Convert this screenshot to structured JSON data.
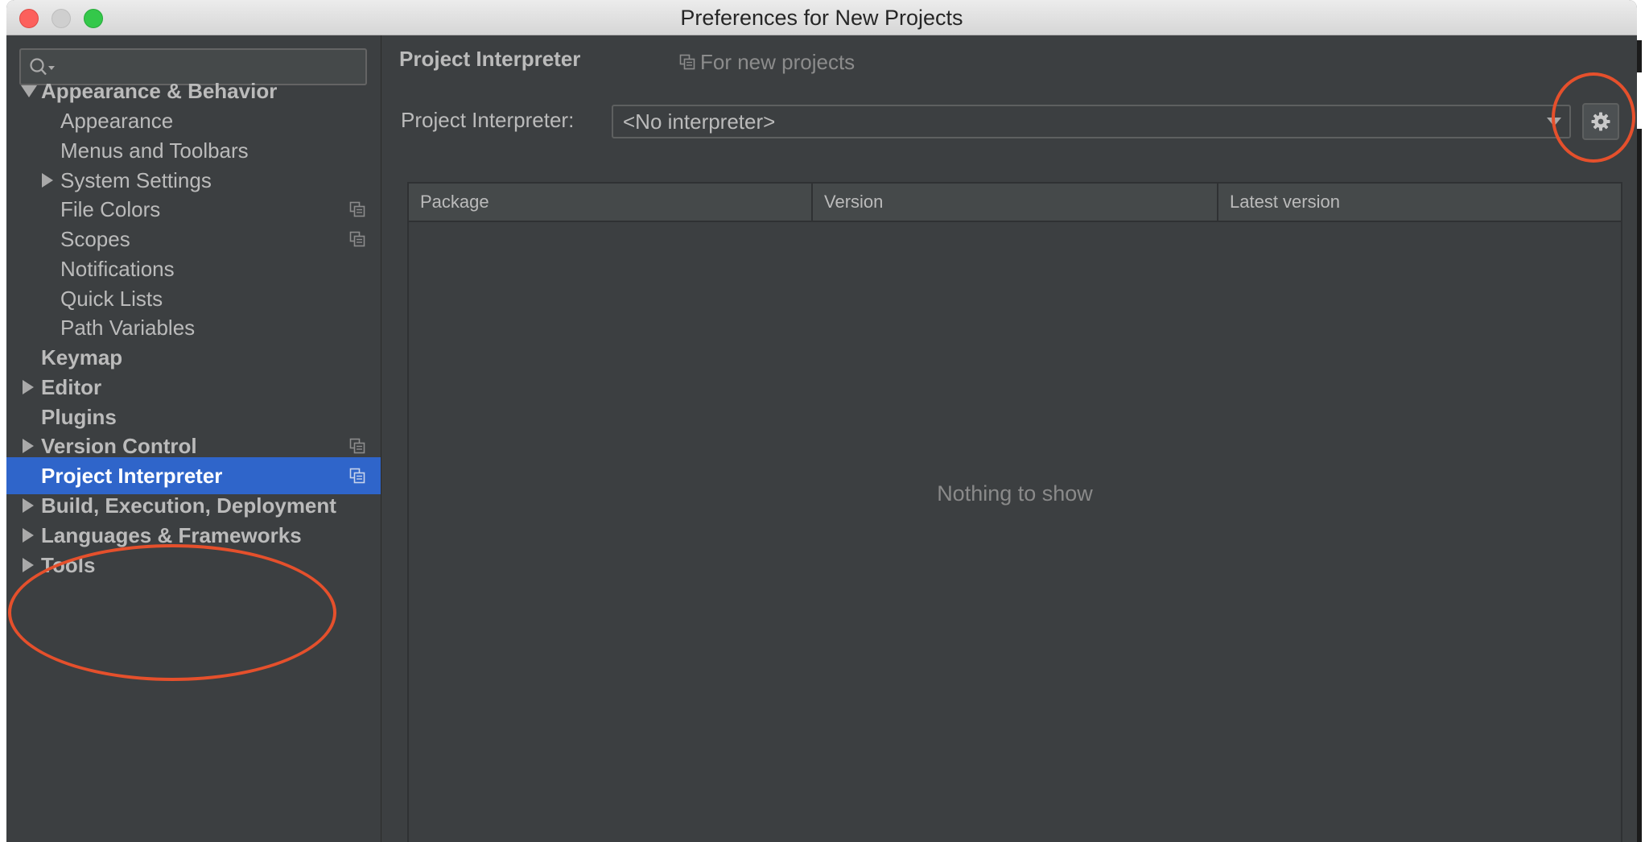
{
  "window": {
    "title": "Preferences for New Projects"
  },
  "sidebar": {
    "search": {
      "value": "",
      "placeholder": ""
    },
    "items": [
      {
        "label": "Appearance & Behavior",
        "bold": true,
        "expanded": true
      },
      {
        "label": "Appearance"
      },
      {
        "label": "Menus and Toolbars"
      },
      {
        "label": "System Settings"
      },
      {
        "label": "File Colors"
      },
      {
        "label": "Scopes"
      },
      {
        "label": "Notifications"
      },
      {
        "label": "Quick Lists"
      },
      {
        "label": "Path Variables"
      },
      {
        "label": "Keymap",
        "bold": true
      },
      {
        "label": "Editor",
        "bold": true
      },
      {
        "label": "Plugins",
        "bold": true
      },
      {
        "label": "Version Control",
        "bold": true
      },
      {
        "label": "Project Interpreter",
        "bold": true,
        "selected": true
      },
      {
        "label": "Build, Execution, Deployment",
        "bold": true
      },
      {
        "label": "Languages & Frameworks",
        "bold": true
      },
      {
        "label": "Tools",
        "bold": true
      }
    ]
  },
  "main": {
    "title": "Project Interpreter",
    "scope_note": "For new projects",
    "interpreter_label": "Project Interpreter:",
    "interpreter_value": "<No interpreter>",
    "table": {
      "columns": [
        "Package",
        "Version",
        "Latest version"
      ],
      "rows": [],
      "empty_text": "Nothing to show"
    }
  },
  "colors": {
    "background": "#3c3f41",
    "selection": "#2f65ca",
    "text": "#bbbbbb",
    "annotation": "#e5502c"
  }
}
